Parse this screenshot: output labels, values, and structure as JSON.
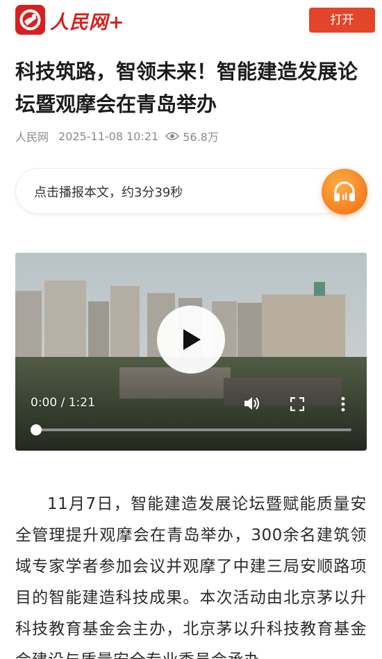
{
  "header": {
    "logo_text": "人民网+",
    "open_button": "打开"
  },
  "article": {
    "title": "科技筑路，智领未来！智能建造发展论坛暨观摩会在青岛举办",
    "source": "人民网",
    "datetime": "2025-11-08 10:21",
    "views": "56.8万",
    "view_icon": "eye-icon"
  },
  "audio": {
    "prompt": "点击播报本文，约3分39秒",
    "icon": "headphones-icon"
  },
  "video": {
    "time_display": "0:00 / 1:21",
    "progress": 0.0,
    "controls": [
      "play-icon",
      "volume-icon",
      "fullscreen-icon",
      "more-options-icon"
    ]
  },
  "body": {
    "paragraph": "11月7日，智能建造发展论坛暨赋能质量安全管理提升观摩会在青岛举办，300余名建筑领域专家学者参加会议并观摩了中建三局安顺路项目的智能建造科技成果。本次活动由北京茅以升科技教育基金会主办，北京茅以升科技教育基金会建设与质量安全专业委员会承办"
  },
  "colors": {
    "brand_red": "#d7201f",
    "open_button": "#e3452a",
    "audio_orange": "#f38420",
    "meta_gray": "#8a8a8a"
  }
}
